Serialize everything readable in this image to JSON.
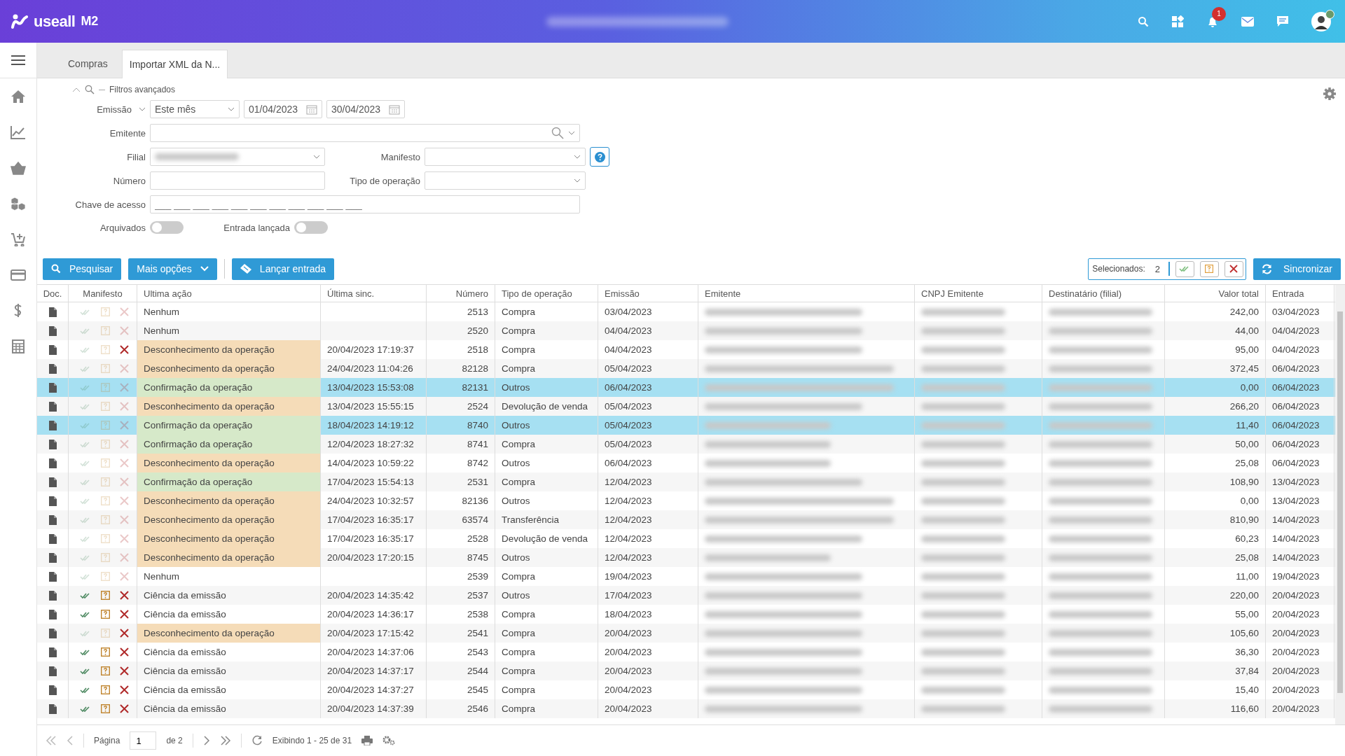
{
  "header": {
    "brand": "useall",
    "product": "M2",
    "notification_count": "1"
  },
  "tabs": [
    {
      "label": "Compras",
      "selected": false
    },
    {
      "label": "Importar XML da N...",
      "selected": true
    }
  ],
  "filters": {
    "title": "Filtros avançados",
    "emission_label": "Emissão",
    "period": "Este mês",
    "date_from": "01/04/2023",
    "date_to": "30/04/2023",
    "emitente_label": "Emitente",
    "filial_label": "Filial",
    "manifesto_label": "Manifesto",
    "numero_label": "Número",
    "tipo_label": "Tipo de operação",
    "chave_label": "Chave de acesso",
    "chave_placeholder": "___ ___ ___ ___ ___ ___ ___ ___ ___ ___ ___",
    "toggles": [
      {
        "label": "Arquivados",
        "on": false
      },
      {
        "label": "Entrada lançada",
        "on": false
      }
    ]
  },
  "toolbar": {
    "buttons": [
      "Pesquisar",
      "Mais opções",
      "Lançar entrada"
    ],
    "selected_label": "Selecionados:",
    "selected_count": "2",
    "sync_button": "Sincronizar"
  },
  "table": {
    "columns": [
      "Doc.",
      "Manifesto",
      "Ultima ação",
      "Última sinc.",
      "Número",
      "Tipo de operação",
      "Emissão",
      "Emitente",
      "CNPJ Emitente",
      "Destinatário (filial)",
      "Valor total",
      "Entrada"
    ],
    "rows": [
      {
        "selected": false,
        "confirm": false,
        "unknown": false,
        "deny": false,
        "kind": "none",
        "action": "Nenhum",
        "sync": "",
        "number": "2513",
        "type": "Compra",
        "emission": "03/04/2023",
        "total": "242,00",
        "entry": "03/04/2023"
      },
      {
        "selected": false,
        "confirm": false,
        "unknown": false,
        "deny": false,
        "kind": "none",
        "action": "Nenhum",
        "sync": "",
        "number": "2520",
        "type": "Compra",
        "emission": "04/04/2023",
        "total": "44,00",
        "entry": "04/04/2023"
      },
      {
        "selected": false,
        "confirm": false,
        "unknown": false,
        "deny": true,
        "kind": "deny",
        "action": "Desconhecimento da operação",
        "sync": "20/04/2023 17:19:37",
        "number": "2518",
        "type": "Compra",
        "emission": "04/04/2023",
        "total": "95,00",
        "entry": "04/04/2023"
      },
      {
        "selected": false,
        "confirm": false,
        "unknown": false,
        "deny": false,
        "kind": "deny",
        "action": "Desconhecimento da operação",
        "sync": "24/04/2023 11:04:26",
        "number": "82128",
        "type": "Compra",
        "emission": "05/04/2023",
        "total": "372,45",
        "entry": "06/04/2023"
      },
      {
        "selected": true,
        "confirm": false,
        "unknown": false,
        "deny": false,
        "kind": "confirm",
        "action": "Confirmação da operação",
        "sync": "13/04/2023 15:53:08",
        "number": "82131",
        "type": "Outros",
        "emission": "06/04/2023",
        "total": "0,00",
        "entry": "06/04/2023"
      },
      {
        "selected": false,
        "confirm": false,
        "unknown": false,
        "deny": false,
        "kind": "deny",
        "action": "Desconhecimento da operação",
        "sync": "13/04/2023 15:55:15",
        "number": "2524",
        "type": "Devolução de venda",
        "emission": "05/04/2023",
        "total": "266,20",
        "entry": "06/04/2023"
      },
      {
        "selected": true,
        "confirm": false,
        "unknown": false,
        "deny": false,
        "kind": "confirm",
        "action": "Confirmação da operação",
        "sync": "18/04/2023 14:19:12",
        "number": "8740",
        "type": "Outros",
        "emission": "05/04/2023",
        "total": "11,40",
        "entry": "06/04/2023"
      },
      {
        "selected": false,
        "confirm": false,
        "unknown": false,
        "deny": false,
        "kind": "confirm",
        "action": "Confirmação da operação",
        "sync": "12/04/2023 18:27:32",
        "number": "8741",
        "type": "Compra",
        "emission": "05/04/2023",
        "total": "50,00",
        "entry": "06/04/2023"
      },
      {
        "selected": false,
        "confirm": false,
        "unknown": false,
        "deny": false,
        "kind": "deny",
        "action": "Desconhecimento da operação",
        "sync": "14/04/2023 10:59:22",
        "number": "8742",
        "type": "Outros",
        "emission": "06/04/2023",
        "total": "25,08",
        "entry": "06/04/2023"
      },
      {
        "selected": false,
        "confirm": false,
        "unknown": false,
        "deny": false,
        "kind": "confirm",
        "action": "Confirmação da operação",
        "sync": "17/04/2023 15:54:13",
        "number": "2531",
        "type": "Compra",
        "emission": "12/04/2023",
        "total": "108,90",
        "entry": "13/04/2023"
      },
      {
        "selected": false,
        "confirm": false,
        "unknown": false,
        "deny": false,
        "kind": "deny",
        "action": "Desconhecimento da operação",
        "sync": "24/04/2023 10:32:57",
        "number": "82136",
        "type": "Outros",
        "emission": "12/04/2023",
        "total": "0,00",
        "entry": "13/04/2023"
      },
      {
        "selected": false,
        "confirm": false,
        "unknown": false,
        "deny": false,
        "kind": "deny",
        "action": "Desconhecimento da operação",
        "sync": "17/04/2023 16:35:17",
        "number": "63574",
        "type": "Transferência",
        "emission": "12/04/2023",
        "total": "810,90",
        "entry": "14/04/2023"
      },
      {
        "selected": false,
        "confirm": false,
        "unknown": false,
        "deny": false,
        "kind": "deny",
        "action": "Desconhecimento da operação",
        "sync": "17/04/2023 16:35:17",
        "number": "2528",
        "type": "Devolução de venda",
        "emission": "12/04/2023",
        "total": "60,23",
        "entry": "14/04/2023"
      },
      {
        "selected": false,
        "confirm": false,
        "unknown": false,
        "deny": false,
        "kind": "deny",
        "action": "Desconhecimento da operação",
        "sync": "20/04/2023 17:20:15",
        "number": "8745",
        "type": "Outros",
        "emission": "12/04/2023",
        "total": "25,08",
        "entry": "14/04/2023"
      },
      {
        "selected": false,
        "confirm": false,
        "unknown": false,
        "deny": false,
        "kind": "none",
        "action": "Nenhum",
        "sync": "",
        "number": "2539",
        "type": "Compra",
        "emission": "19/04/2023",
        "total": "11,00",
        "entry": "19/04/2023"
      },
      {
        "selected": false,
        "confirm": true,
        "unknown": true,
        "deny": true,
        "kind": "science",
        "action": "Ciência da emissão",
        "sync": "20/04/2023 14:35:42",
        "number": "2537",
        "type": "Outros",
        "emission": "17/04/2023",
        "total": "220,00",
        "entry": "20/04/2023"
      },
      {
        "selected": false,
        "confirm": true,
        "unknown": true,
        "deny": true,
        "kind": "science",
        "action": "Ciência da emissão",
        "sync": "20/04/2023 14:36:17",
        "number": "2538",
        "type": "Compra",
        "emission": "18/04/2023",
        "total": "55,00",
        "entry": "20/04/2023"
      },
      {
        "selected": false,
        "confirm": false,
        "unknown": false,
        "deny": true,
        "kind": "deny",
        "action": "Desconhecimento da operação",
        "sync": "20/04/2023 17:15:42",
        "number": "2541",
        "type": "Compra",
        "emission": "20/04/2023",
        "total": "105,60",
        "entry": "20/04/2023"
      },
      {
        "selected": false,
        "confirm": true,
        "unknown": true,
        "deny": true,
        "kind": "science",
        "action": "Ciência da emissão",
        "sync": "20/04/2023 14:37:06",
        "number": "2543",
        "type": "Compra",
        "emission": "20/04/2023",
        "total": "36,30",
        "entry": "20/04/2023"
      },
      {
        "selected": false,
        "confirm": true,
        "unknown": true,
        "deny": true,
        "kind": "science",
        "action": "Ciência da emissão",
        "sync": "20/04/2023 14:37:17",
        "number": "2544",
        "type": "Compra",
        "emission": "20/04/2023",
        "total": "37,84",
        "entry": "20/04/2023"
      },
      {
        "selected": false,
        "confirm": true,
        "unknown": true,
        "deny": true,
        "kind": "science",
        "action": "Ciência da emissão",
        "sync": "20/04/2023 14:37:27",
        "number": "2545",
        "type": "Compra",
        "emission": "20/04/2023",
        "total": "15,40",
        "entry": "20/04/2023"
      },
      {
        "selected": false,
        "confirm": true,
        "unknown": true,
        "deny": true,
        "kind": "science",
        "action": "Ciência da emissão",
        "sync": "20/04/2023 14:37:39",
        "number": "2546",
        "type": "Compra",
        "emission": "20/04/2023",
        "total": "116,60",
        "entry": "20/04/2023"
      }
    ]
  },
  "pager": {
    "page_label": "Página",
    "page": "1",
    "of_label": "de 2",
    "summary": "Exibindo 1 - 25 de 31"
  }
}
